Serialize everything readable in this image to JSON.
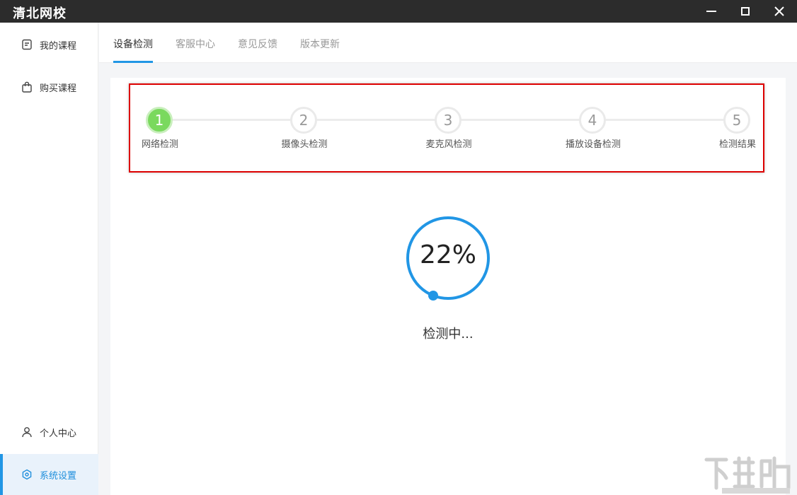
{
  "window": {
    "title": "清北网校",
    "minimize_icon": "minimize-icon",
    "maximize_icon": "maximize-icon",
    "close_icon": "close-icon"
  },
  "sidebar": {
    "items": [
      {
        "label": "我的课程",
        "icon": "document-icon"
      },
      {
        "label": "购买课程",
        "icon": "shopping-bag-icon"
      },
      {
        "label": "个人中心",
        "icon": "user-icon"
      },
      {
        "label": "系统设置",
        "icon": "settings-hex-icon",
        "active": true
      }
    ]
  },
  "tabs": [
    {
      "label": "设备检测",
      "active": true
    },
    {
      "label": "客服中心"
    },
    {
      "label": "意见反馈"
    },
    {
      "label": "版本更新"
    }
  ],
  "steps": [
    {
      "number": "1",
      "label": "网络检测",
      "state": "done"
    },
    {
      "number": "2",
      "label": "摄像头检测"
    },
    {
      "number": "3",
      "label": "麦克风检测"
    },
    {
      "number": "4",
      "label": "播放设备检测"
    },
    {
      "number": "5",
      "label": "检测结果"
    }
  ],
  "progress": {
    "percent_text": "22%",
    "value": 0.22,
    "status": "检测中..."
  },
  "colors": {
    "accent": "#2196e5",
    "step_done": "#7ad95e",
    "highlight_border": "#dd0000",
    "titlebar": "#2c2c2c"
  }
}
